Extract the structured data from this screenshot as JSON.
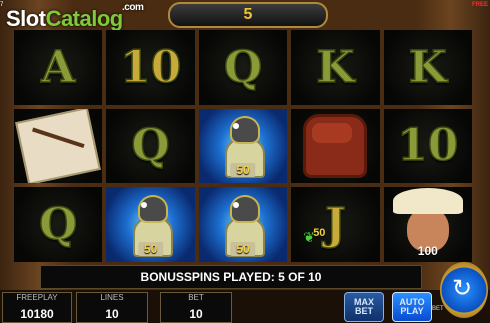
{
  "header": {
    "logo_main": "Slot",
    "logo_accent": "Catalog",
    "logo_suffix": ".com",
    "counter": "5",
    "corner_left": "7",
    "corner_right": "FREE"
  },
  "reels": [
    [
      "A",
      "10",
      "Q",
      "K",
      "K"
    ],
    [
      "map",
      "Q",
      "bird",
      "bag",
      "10"
    ],
    [
      "Q",
      "bird",
      "bird",
      "J",
      "explorer"
    ]
  ],
  "symbol_values": {
    "bird_1": "50",
    "bird_2": "50",
    "bird_3": "50",
    "j_leaf": "50",
    "explorer": "100"
  },
  "banner_text": "BONUSSPINS PLAYED: 5 OF 10",
  "panel": {
    "freeplay_label": "FREEPLAY",
    "freeplay_value": "10180",
    "lines_label": "LINES",
    "lines_value": "10",
    "bet_label": "BET",
    "bet_value": "10",
    "max_bet_line1": "MAX",
    "max_bet_line2": "BET",
    "auto_play_line1": "AUTO",
    "auto_play_line2": "PLAY",
    "bet_small_label": "BET"
  },
  "icons": {
    "spin": "refresh-icon",
    "leaf": "leaf-icon"
  },
  "colors": {
    "gold": "#f2c230",
    "panel_text": "#ffffff",
    "glow": "#1c6fd0"
  }
}
